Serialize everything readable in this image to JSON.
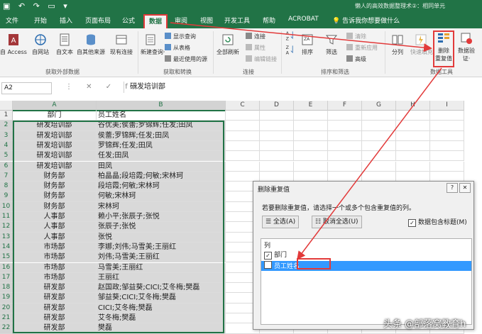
{
  "titlebar": {
    "qat": "▣ ↶ ↷ ▭ ▾",
    "title": "懒人的高效数据整理术②：相同单元"
  },
  "tabs": [
    "文件",
    "开始",
    "插入",
    "页面布局",
    "公式",
    "数据",
    "审阅",
    "视图",
    "开发工具",
    "帮助",
    "ACROBAT"
  ],
  "active_tab": "数据",
  "tellme": "告诉我你想要做什么",
  "ribbon": {
    "get_external": {
      "buttons": [
        "自 Access",
        "自网站",
        "自文本",
        "自其他来源",
        "现有连接"
      ],
      "group": "获取外部数据"
    },
    "transform": {
      "new_query": "新建查询·",
      "items": [
        "显示查询",
        "从表格",
        "最近使用的源"
      ],
      "group": "获取和转换"
    },
    "connections": {
      "refresh": "全部刷新",
      "items": [
        "连接",
        "属性",
        "编辑链接"
      ],
      "group": "连接"
    },
    "sort_filter": {
      "sort": "排序",
      "filter": "筛选",
      "items": [
        "清除",
        "重新应用",
        "高级"
      ],
      "group": "排序和筛选"
    },
    "data_tools": {
      "split": "分列",
      "flash_fill": "快速填充",
      "remove_dup_1": "删除",
      "remove_dup_2": "重复值",
      "validation_1": "数据验",
      "validation_2": "证·",
      "group": "数据工具"
    }
  },
  "formula_bar": {
    "namebox": "A2",
    "icons": "⋮ ✕ ✓ fx",
    "content": "研发培训部"
  },
  "grid": {
    "columns": [
      "A",
      "B",
      "C",
      "D",
      "E",
      "F",
      "G",
      "H",
      "I"
    ],
    "header_row": [
      "部门",
      "员工姓名"
    ],
    "rows": [
      [
        "研发培训部",
        "谷优美;侯蕾;罗锦辉;任发;田凤"
      ],
      [
        "研发培训部",
        "侯蕾;罗锦辉;任发;田凤"
      ],
      [
        "研发培训部",
        "罗锦辉;任发;田凤"
      ],
      [
        "研发培训部",
        "任发;田凤"
      ],
      [
        "研发培训部",
        "田凤"
      ],
      [
        "财务部",
        "柏晶晶;段培霞;何敏;宋林珂"
      ],
      [
        "财务部",
        "段培霞;何敏;宋林珂"
      ],
      [
        "财务部",
        "何敏;宋林珂"
      ],
      [
        "财务部",
        "宋林珂"
      ],
      [
        "人事部",
        "赖小平;张辰子;张悦"
      ],
      [
        "人事部",
        "张辰子;张悦"
      ],
      [
        "人事部",
        "张悦"
      ],
      [
        "市场部",
        "李娜;刘伟;马雪美;王丽红"
      ],
      [
        "市场部",
        "刘伟;马雪美;王丽红"
      ],
      [
        "市场部",
        "马雪美;王丽红"
      ],
      [
        "市场部",
        "王丽红"
      ],
      [
        "研发部",
        "赵国政;邹益葵;CICI;艾冬梅;樊磊"
      ],
      [
        "研发部",
        "邹益葵;CICI;艾冬梅;樊磊"
      ],
      [
        "研发部",
        "CICI;艾冬梅;樊磊"
      ],
      [
        "研发部",
        "艾冬梅;樊磊"
      ],
      [
        "研发部",
        "樊磊"
      ]
    ]
  },
  "dialog": {
    "title": "删除重复值",
    "help": "?",
    "close": "✕",
    "instruction": "若要删除重复值，请选择一个或多个包含重复值的列。",
    "select_all": "☰ 全选(A)",
    "unselect_all": "☷ 取消全选(U)",
    "has_header": "数据包含标题(M)",
    "list_header": "列",
    "items": [
      {
        "label": "部门",
        "checked": true
      },
      {
        "label": "员工姓名",
        "checked": false
      }
    ]
  },
  "check_mark": "✓",
  "watermark": "头条 @部落窝教育h",
  "colors": {
    "excel_green": "#217346",
    "highlight_red": "#e23a3a",
    "selection_blue": "#3399ff"
  }
}
